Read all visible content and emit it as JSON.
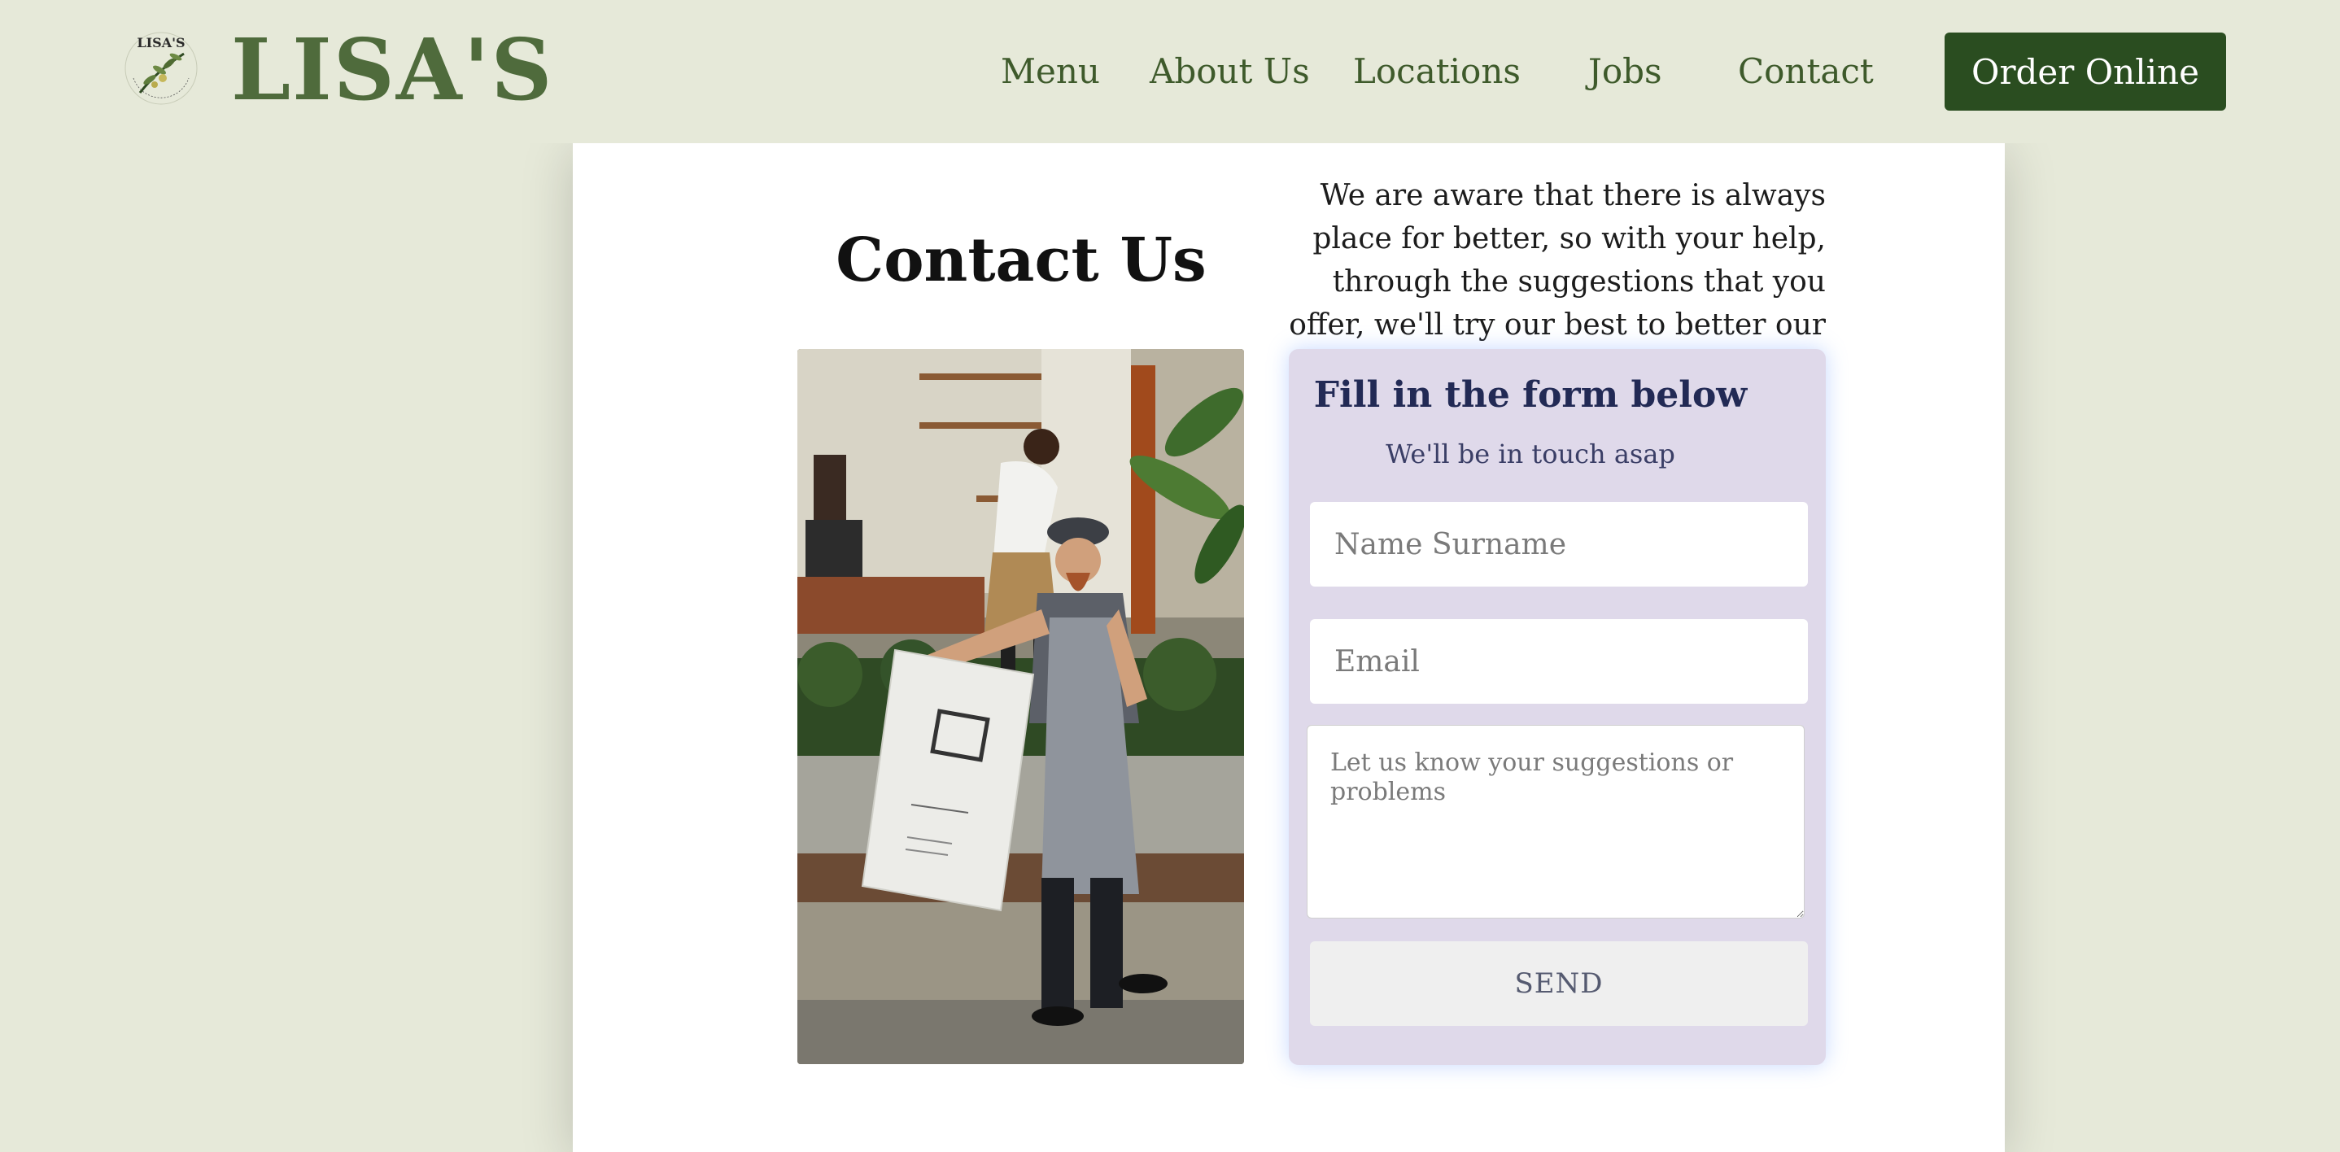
{
  "header": {
    "logo_alt": "LISA'S",
    "brand": "LISA'S",
    "nav": [
      "Menu",
      "About Us",
      "Locations",
      "Jobs",
      "Contact"
    ],
    "cta": "Order Online"
  },
  "main": {
    "title": "Contact Us",
    "intro": "We are aware that there is always place for better, so with your help, through the suggestions that you offer, we'll try our best to better our services and products.",
    "photo_alt": "Staff carrying a sign outside a cafe"
  },
  "form": {
    "heading": "Fill in the form below",
    "subheading": "We'll be in touch asap",
    "name_placeholder": "Name Surname",
    "email_placeholder": "Email",
    "message_placeholder": "Let us know your suggestions or problems",
    "send_label": "SEND"
  },
  "colors": {
    "page_bg": "#e6e9d9",
    "brand_green": "#4f6b3c",
    "cta_green": "#2a4d20",
    "form_bg": "#dfd9ea"
  }
}
